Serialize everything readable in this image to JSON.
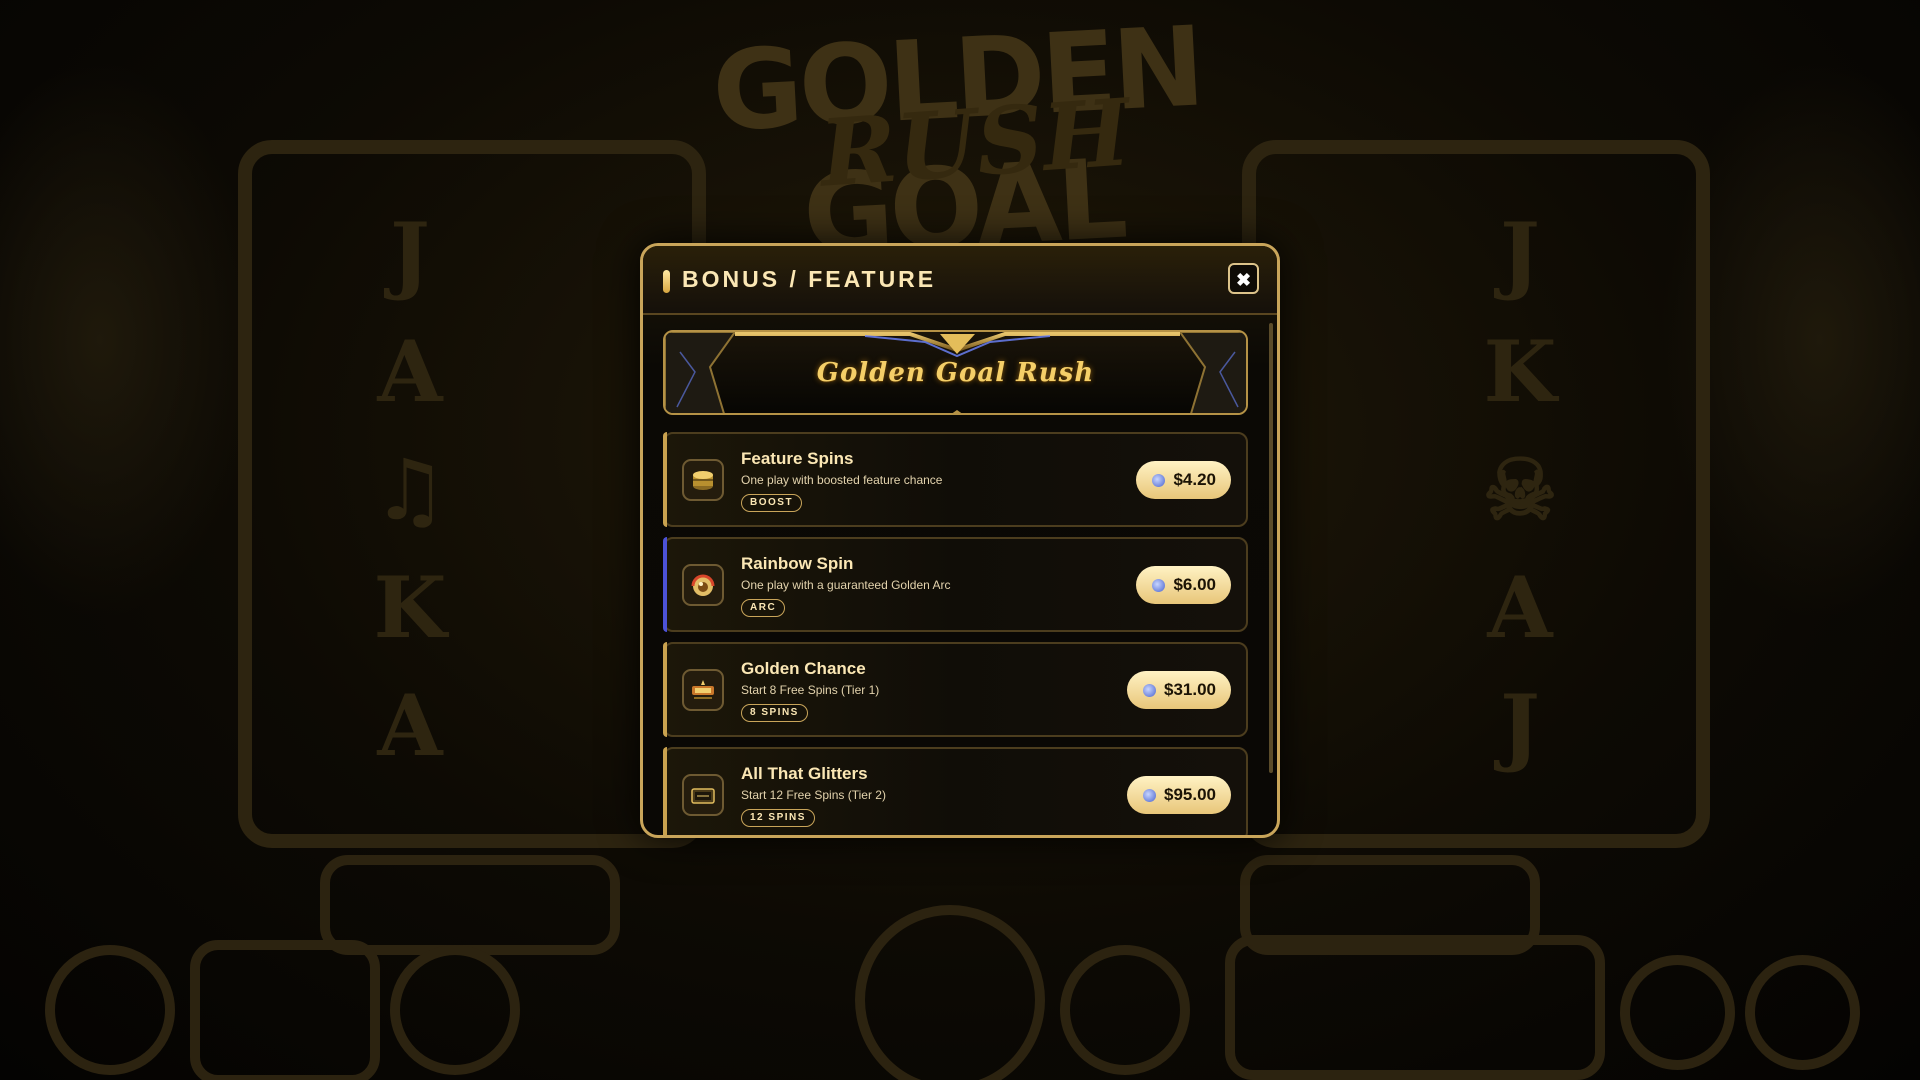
{
  "modal": {
    "title": "BONUS / FEATURE",
    "close_icon": "✖",
    "banner_title": "Golden Goal Rush",
    "items": [
      {
        "title": "Feature Spins",
        "description": "One play with boosted feature chance",
        "tag": "BOOST",
        "price": "$4.20",
        "icon": "coin-stack-icon"
      },
      {
        "title": "Rainbow Spin",
        "description": "One play with a guaranteed Golden Arc",
        "tag": "ARC",
        "price": "$6.00",
        "icon": "rainbow-ball-icon"
      },
      {
        "title": "Golden Chance",
        "description": "Start 8 Free Spins (Tier 1)",
        "tag": "8 SPINS",
        "price": "$31.00",
        "icon": "golden-chance-icon"
      },
      {
        "title": "All That Glitters",
        "description": "Start 12 Free Spins (Tier 2)",
        "tag": "12 SPINS",
        "price": "$95.00",
        "icon": "glitter-chest-icon"
      }
    ]
  },
  "colors": {
    "gold": "#c9a55a",
    "arc_accent": "#4c52d8",
    "price_button": "#f3d995"
  }
}
